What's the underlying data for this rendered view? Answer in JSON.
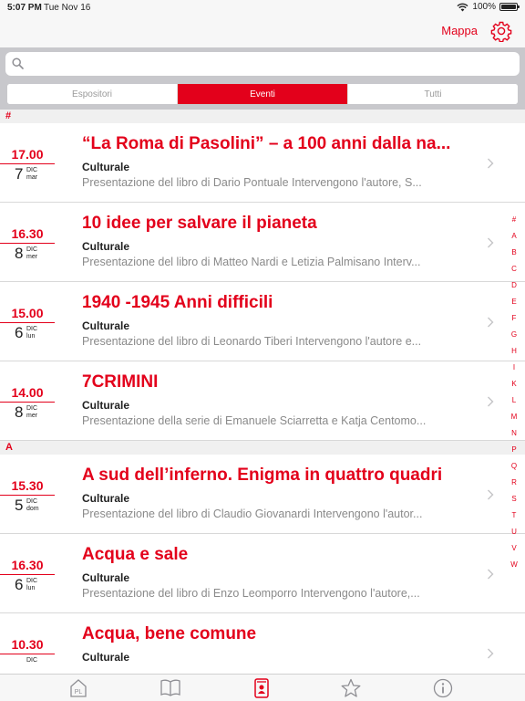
{
  "status_bar": {
    "time": "5:07 PM",
    "date": "Tue Nov 16",
    "battery": "100%"
  },
  "nav": {
    "map_label": "Mappa",
    "settings_icon": "gear-icon"
  },
  "search": {
    "placeholder": "",
    "value": ""
  },
  "segments": [
    {
      "label": "Espositori",
      "active": false
    },
    {
      "label": "Eventi",
      "active": true
    },
    {
      "label": "Tutti",
      "active": false
    }
  ],
  "sections": [
    {
      "header": "#",
      "events": [
        {
          "time": "17.00",
          "day": "7",
          "month": "DIC",
          "weekday": "mar",
          "title": "“La Roma di Pasolini” – a 100 anni dalla na...",
          "category": "Culturale",
          "desc": "Presentazione del libro di Dario Pontuale Intervengono l'autore, S..."
        },
        {
          "time": "16.30",
          "day": "8",
          "month": "DIC",
          "weekday": "mer",
          "title": "10 idee per salvare il pianeta",
          "category": "Culturale",
          "desc": "Presentazione del libro di Matteo Nardi e Letizia Palmisano Interv..."
        },
        {
          "time": "15.00",
          "day": "6",
          "month": "DIC",
          "weekday": "lun",
          "title": "1940 -1945 Anni difficili",
          "category": "Culturale",
          "desc": "Presentazione del libro di Leonardo Tiberi Intervengono l'autore e..."
        },
        {
          "time": "14.00",
          "day": "8",
          "month": "DIC",
          "weekday": "mer",
          "title": "7CRIMINI",
          "category": "Culturale",
          "desc": "Presentazione della serie di Emanuele Sciarretta e Katja Centomo..."
        }
      ]
    },
    {
      "header": "A",
      "events": [
        {
          "time": "15.30",
          "day": "5",
          "month": "DIC",
          "weekday": "dom",
          "title": "A sud dell’inferno. Enigma in quattro quadri",
          "category": "Culturale",
          "desc": "Presentazione del libro di Claudio Giovanardi Intervengono l'autor..."
        },
        {
          "time": "16.30",
          "day": "6",
          "month": "DIC",
          "weekday": "lun",
          "title": "Acqua e sale",
          "category": "Culturale",
          "desc": "Presentazione del libro di Enzo Leomporro Intervengono l'autore,..."
        },
        {
          "time": "10.30",
          "day": "",
          "month": "DIC",
          "weekday": "",
          "title": "Acqua, bene comune",
          "category": "Culturale",
          "desc": ""
        }
      ]
    }
  ],
  "index_letters": [
    "#",
    "A",
    "B",
    "C",
    "D",
    "E",
    "F",
    "G",
    "H",
    "I",
    "K",
    "L",
    "M",
    "N",
    "P",
    "Q",
    "R",
    "S",
    "T",
    "U",
    "V",
    "W"
  ],
  "tabbar": {
    "items": [
      {
        "icon": "pl-logo-icon",
        "label": "PL"
      },
      {
        "icon": "book-icon"
      },
      {
        "icon": "contact-card-icon",
        "active": true
      },
      {
        "icon": "star-icon"
      },
      {
        "icon": "info-icon"
      }
    ]
  },
  "colors": {
    "accent": "#e3001b",
    "muted": "#8a8a8a",
    "bar_bg": "#f7f7f7",
    "search_bg": "#c8c8cc"
  }
}
